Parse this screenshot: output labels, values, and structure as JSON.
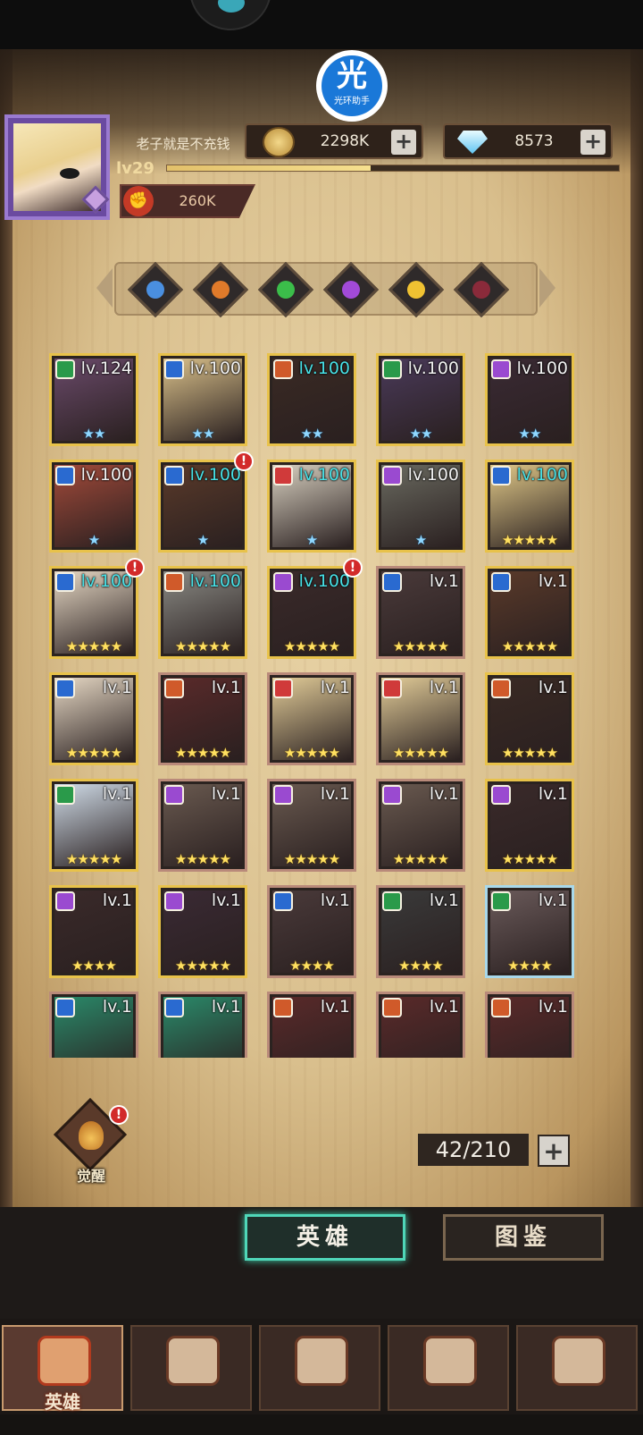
{
  "badge": {
    "char": "光",
    "label": "光环助手"
  },
  "player": {
    "name": "老子就是不充钱",
    "level": "lv29",
    "xp_fraction": 0.45,
    "power": "260K"
  },
  "currency": {
    "gold": "2298K",
    "gems": "8573",
    "plus": "+"
  },
  "factions": [
    {
      "name": "faction-blue-icon",
      "color": "#4a8fe0"
    },
    {
      "name": "faction-orange-icon",
      "color": "#e07a2a"
    },
    {
      "name": "faction-green-icon",
      "color": "#3bbd4a"
    },
    {
      "name": "faction-purple-icon",
      "color": "#a24ad8"
    },
    {
      "name": "faction-yellow-icon",
      "color": "#f0c232"
    },
    {
      "name": "faction-dark-icon",
      "color": "#8a2a3a"
    }
  ],
  "heroes": [
    {
      "lv": "lv.124",
      "stars": "★★",
      "star_color": "blue",
      "lv_color": "white",
      "frame": "gold",
      "cls": "#2a9a4a",
      "bg": "#6a4a6a",
      "alert": false
    },
    {
      "lv": "lv.100",
      "stars": "★★",
      "star_color": "blue",
      "lv_color": "white",
      "frame": "gold",
      "cls": "#2a6ad0",
      "bg": "#d9c08a",
      "alert": false
    },
    {
      "lv": "lv.100",
      "stars": "★★",
      "star_color": "blue",
      "lv_color": "cyan",
      "frame": "gold",
      "cls": "#d05a2a",
      "bg": "#3a2a24",
      "alert": false
    },
    {
      "lv": "lv.100",
      "stars": "★★",
      "star_color": "blue",
      "lv_color": "white",
      "frame": "gold",
      "cls": "#2a9a4a",
      "bg": "#4a3a5a",
      "alert": false
    },
    {
      "lv": "lv.100",
      "stars": "★★",
      "star_color": "blue",
      "lv_color": "white",
      "frame": "gold",
      "cls": "#9a4ad0",
      "bg": "#3a2a34",
      "alert": false
    },
    {
      "lv": "lv.100",
      "stars": "★",
      "star_color": "blue",
      "lv_color": "white",
      "frame": "gold",
      "cls": "#2a6ad0",
      "bg": "#a24a3a",
      "alert": false
    },
    {
      "lv": "lv.100",
      "stars": "★",
      "star_color": "blue",
      "lv_color": "cyan",
      "frame": "gold",
      "cls": "#2a6ad0",
      "bg": "#5a3a2a",
      "alert": true
    },
    {
      "lv": "lv.100",
      "stars": "★",
      "star_color": "blue",
      "lv_color": "cyan",
      "frame": "gold",
      "cls": "#d03a3a",
      "bg": "#d8d0c0",
      "alert": false
    },
    {
      "lv": "lv.100",
      "stars": "★",
      "star_color": "blue",
      "lv_color": "white",
      "frame": "gold",
      "cls": "#9a4ad0",
      "bg": "#6a6a60",
      "alert": false
    },
    {
      "lv": "lv.100",
      "stars": "★★★★★",
      "star_color": "gold",
      "lv_color": "cyan",
      "frame": "gold",
      "cls": "#2a6ad0",
      "bg": "#e0c888",
      "alert": false
    },
    {
      "lv": "lv.100",
      "stars": "★★★★★",
      "star_color": "gold",
      "lv_color": "cyan",
      "frame": "gold",
      "cls": "#2a6ad0",
      "bg": "#e6d8c4",
      "alert": true
    },
    {
      "lv": "lv.100",
      "stars": "★★★★★",
      "star_color": "gold",
      "lv_color": "cyan",
      "frame": "gold",
      "cls": "#d05a2a",
      "bg": "#8a8a84",
      "alert": false
    },
    {
      "lv": "lv.100",
      "stars": "★★★★★",
      "star_color": "gold",
      "lv_color": "cyan",
      "frame": "gold",
      "cls": "#9a4ad0",
      "bg": "#3a2a2a",
      "alert": true
    },
    {
      "lv": "lv.1",
      "stars": "★★★★★",
      "star_color": "gold",
      "lv_color": "white",
      "frame": "silver",
      "cls": "#2a6ad0",
      "bg": "#4a3a3a",
      "alert": false
    },
    {
      "lv": "lv.1",
      "stars": "★★★★★",
      "star_color": "gold",
      "lv_color": "white",
      "frame": "gold",
      "cls": "#2a6ad0",
      "bg": "#5a3a2a",
      "alert": false
    },
    {
      "lv": "lv.1",
      "stars": "★★★★★",
      "star_color": "gold",
      "lv_color": "white",
      "frame": "gold",
      "cls": "#2a6ad0",
      "bg": "#e6d8c4",
      "alert": false
    },
    {
      "lv": "lv.1",
      "stars": "★★★★★",
      "star_color": "gold",
      "lv_color": "white",
      "frame": "silver",
      "cls": "#d05a2a",
      "bg": "#5a2a2a",
      "alert": false
    },
    {
      "lv": "lv.1",
      "stars": "★★★★★",
      "star_color": "gold",
      "lv_color": "white",
      "frame": "silver",
      "cls": "#d03a3a",
      "bg": "#e2cc98",
      "alert": false
    },
    {
      "lv": "lv.1",
      "stars": "★★★★★",
      "star_color": "gold",
      "lv_color": "white",
      "frame": "silver",
      "cls": "#d03a3a",
      "bg": "#e2cc98",
      "alert": false
    },
    {
      "lv": "lv.1",
      "stars": "★★★★★",
      "star_color": "gold",
      "lv_color": "white",
      "frame": "gold",
      "cls": "#d05a2a",
      "bg": "#3a2a24",
      "alert": false
    },
    {
      "lv": "lv.1",
      "stars": "★★★★★",
      "star_color": "gold",
      "lv_color": "white",
      "frame": "gold",
      "cls": "#2a9a4a",
      "bg": "#d0dce8",
      "alert": false
    },
    {
      "lv": "lv.1",
      "stars": "★★★★★",
      "star_color": "gold",
      "lv_color": "white",
      "frame": "silver",
      "cls": "#9a4ad0",
      "bg": "#6a5a50",
      "alert": false
    },
    {
      "lv": "lv.1",
      "stars": "★★★★★",
      "star_color": "gold",
      "lv_color": "white",
      "frame": "silver",
      "cls": "#9a4ad0",
      "bg": "#6a5a50",
      "alert": false
    },
    {
      "lv": "lv.1",
      "stars": "★★★★★",
      "star_color": "gold",
      "lv_color": "white",
      "frame": "silver",
      "cls": "#9a4ad0",
      "bg": "#6a5a50",
      "alert": false
    },
    {
      "lv": "lv.1",
      "stars": "★★★★★",
      "star_color": "gold",
      "lv_color": "white",
      "frame": "gold",
      "cls": "#9a4ad0",
      "bg": "#3a2a2a",
      "alert": false
    },
    {
      "lv": "lv.1",
      "stars": "★★★★",
      "star_color": "gold",
      "lv_color": "white",
      "frame": "gold",
      "cls": "#9a4ad0",
      "bg": "#3a2a2a",
      "alert": false
    },
    {
      "lv": "lv.1",
      "stars": "★★★★★",
      "star_color": "gold",
      "lv_color": "white",
      "frame": "gold",
      "cls": "#9a4ad0",
      "bg": "#3a2a34",
      "alert": false
    },
    {
      "lv": "lv.1",
      "stars": "★★★★",
      "star_color": "gold",
      "lv_color": "white",
      "frame": "silver",
      "cls": "#2a6ad0",
      "bg": "#4a3a3a",
      "alert": false
    },
    {
      "lv": "lv.1",
      "stars": "★★★★",
      "star_color": "gold",
      "lv_color": "white",
      "frame": "silver",
      "cls": "#2a9a4a",
      "bg": "#3a3a3a",
      "alert": false
    },
    {
      "lv": "lv.1",
      "stars": "★★★★",
      "star_color": "gold",
      "lv_color": "white",
      "frame": "ice",
      "cls": "#2a9a4a",
      "bg": "#6a5a5a",
      "alert": false
    },
    {
      "lv": "lv.1",
      "stars": "",
      "star_color": "gold",
      "lv_color": "white",
      "frame": "silver",
      "cls": "#2a6ad0",
      "bg": "#2a8a6a",
      "alert": false
    },
    {
      "lv": "lv.1",
      "stars": "",
      "star_color": "gold",
      "lv_color": "white",
      "frame": "silver",
      "cls": "#2a6ad0",
      "bg": "#2a8a6a",
      "alert": false
    },
    {
      "lv": "lv.1",
      "stars": "",
      "star_color": "gold",
      "lv_color": "white",
      "frame": "silver",
      "cls": "#d05a2a",
      "bg": "#5a2a2a",
      "alert": false
    },
    {
      "lv": "lv.1",
      "stars": "",
      "star_color": "gold",
      "lv_color": "white",
      "frame": "silver",
      "cls": "#d05a2a",
      "bg": "#5a2a2a",
      "alert": false
    },
    {
      "lv": "lv.1",
      "stars": "",
      "star_color": "gold",
      "lv_color": "white",
      "frame": "silver",
      "cls": "#d05a2a",
      "bg": "#5a2a2a",
      "alert": false
    }
  ],
  "awaken": {
    "label": "觉醒",
    "alert": "!"
  },
  "hero_count": "42/210",
  "tabs": {
    "heroes": "英雄",
    "codex": "图鉴"
  },
  "nav": [
    {
      "name": "nav-heroes",
      "label": "英雄",
      "active": true
    },
    {
      "name": "nav-adventure",
      "label": "",
      "active": false
    },
    {
      "name": "nav-battle",
      "label": "",
      "active": false
    },
    {
      "name": "nav-castle",
      "label": "",
      "active": false
    },
    {
      "name": "nav-guild",
      "label": "",
      "active": false
    }
  ]
}
